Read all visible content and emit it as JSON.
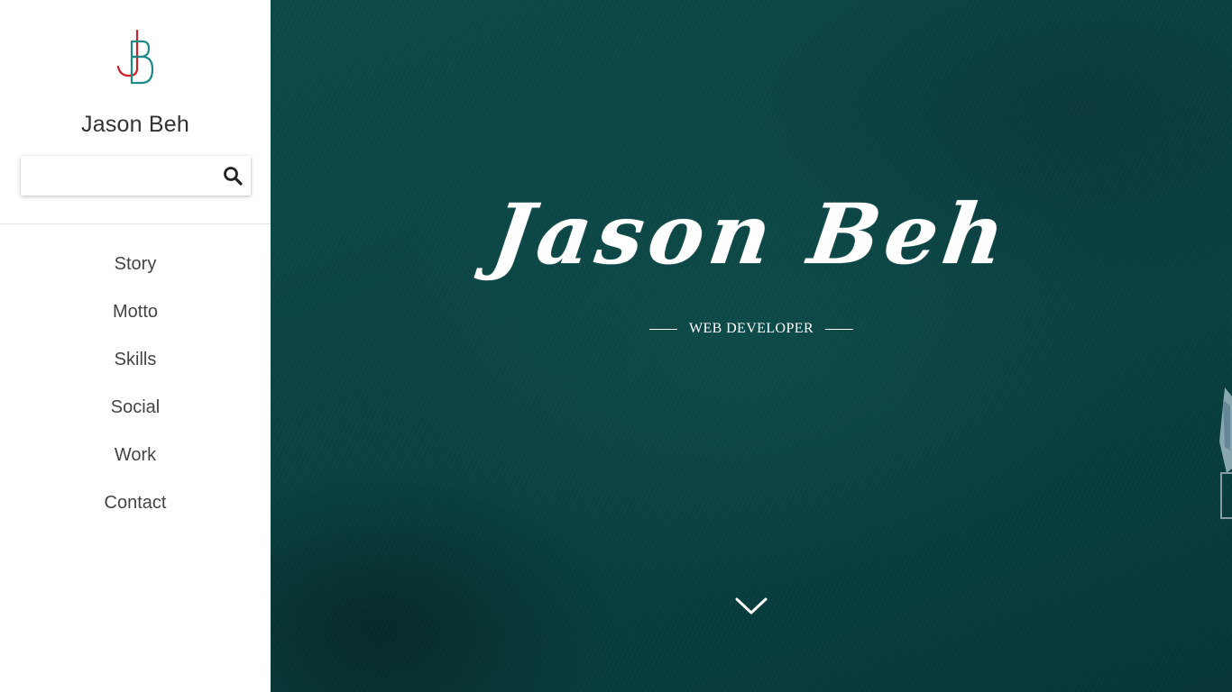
{
  "sidebar": {
    "logo_alt": "JB",
    "site_name": "Jason Beh",
    "search": {
      "value": "",
      "placeholder": ""
    },
    "search_icon": "search-icon",
    "nav_items": [
      {
        "label": "Story"
      },
      {
        "label": "Motto"
      },
      {
        "label": "Skills"
      },
      {
        "label": "Social"
      },
      {
        "label": "Work"
      },
      {
        "label": "Contact"
      }
    ]
  },
  "hero": {
    "title": "Jason Beh",
    "subtitle": "WEB DEVELOPER",
    "scroll_icon": "chevron-down-icon"
  },
  "colors": {
    "logo_red": "#d0202a",
    "logo_teal": "#1d8a8a",
    "sidebar_bg": "#ffffff",
    "hero_bg": "#0b4444",
    "hero_text": "#ffffff",
    "nav_text": "#444444"
  }
}
